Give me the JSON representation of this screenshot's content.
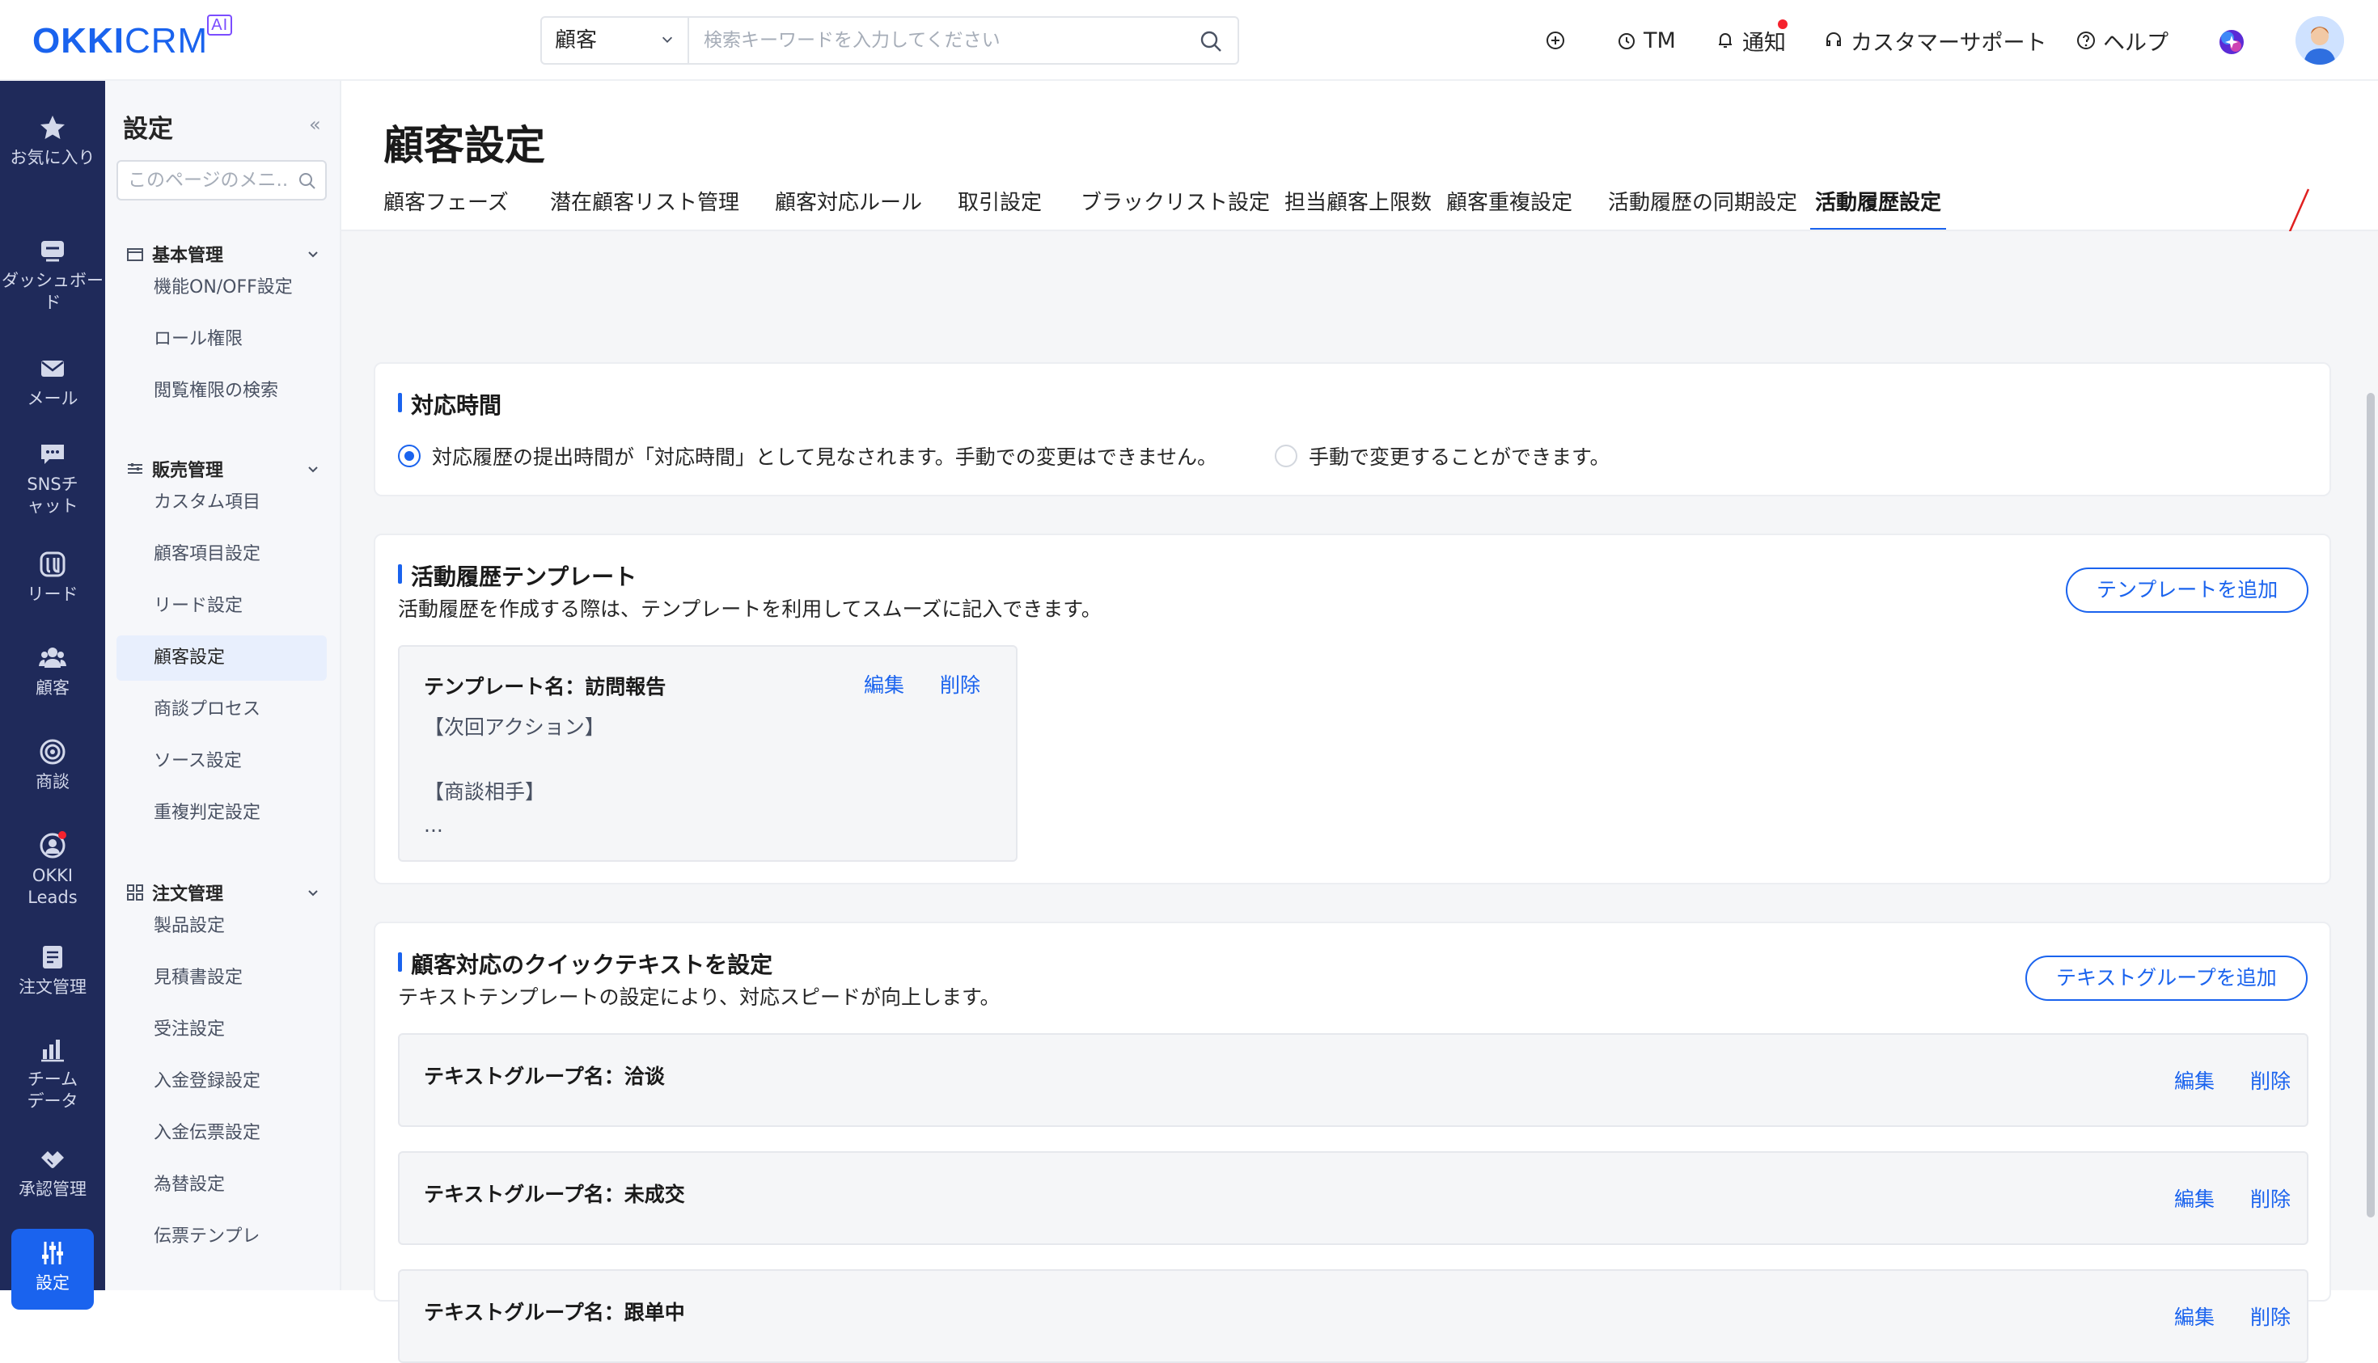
{
  "brand": {
    "name": "OKKI",
    "crm": "CRM",
    "ai": "AI"
  },
  "search": {
    "scope": "顧客",
    "placeholder": "検索キーワードを入力してください"
  },
  "topbar": {
    "tm": "TM",
    "notify": "通知",
    "support": "カスタマーサポート",
    "help": "ヘルプ"
  },
  "leftnav": [
    {
      "label": "お気に入り",
      "icon": "star-icon"
    },
    {
      "label": "ダッシュボード",
      "icon": "dashboard-icon"
    },
    {
      "label": "メール",
      "icon": "mail-icon"
    },
    {
      "label": "SNSチャット",
      "icon": "chat-icon"
    },
    {
      "label": "リード",
      "icon": "lead-icon"
    },
    {
      "label": "顧客",
      "icon": "customer-icon"
    },
    {
      "label": "商談",
      "icon": "target-icon"
    },
    {
      "label": "OKKI Leads",
      "icon": "leads-icon"
    },
    {
      "label": "注文管理",
      "icon": "order-icon"
    },
    {
      "label": "チームデータ",
      "icon": "chart-icon"
    },
    {
      "label": "承認管理",
      "icon": "approve-icon"
    },
    {
      "label": "設定",
      "icon": "settings-icon"
    }
  ],
  "subnav": {
    "title": "設定",
    "collapse": "«",
    "search_placeholder": "このページのメニ...",
    "groups": [
      {
        "label": "基本管理",
        "items": [
          "機能ON/OFF設定",
          "ロール権限",
          "閲覧権限の検索"
        ]
      },
      {
        "label": "販売管理",
        "items": [
          "カスタム項目",
          "顧客項目設定",
          "リード設定",
          "顧客設定",
          "商談プロセス",
          "ソース設定",
          "重複判定設定"
        ]
      },
      {
        "label": "注文管理",
        "items": [
          "製品設定",
          "見積書設定",
          "受注設定",
          "入金登録設定",
          "入金伝票設定",
          "為替設定",
          "伝票テンプレ"
        ]
      }
    ]
  },
  "page": {
    "title": "顧客設定",
    "tabs": [
      "顧客フェーズ",
      "潜在顧客リスト管理",
      "顧客対応ルール",
      "取引設定",
      "ブラックリスト設定",
      "担当顧客上限数",
      "顧客重複設定",
      "活動履歴の同期設定",
      "活動履歴設定"
    ]
  },
  "response_time": {
    "title": "対応時間",
    "option1": "対応履歴の提出時間が「対応時間」として見なされます。手動での変更はできません。",
    "option2": "手動で変更することができます。"
  },
  "template": {
    "title": "活動履歴テンプレート",
    "desc": "活動履歴を作成する際は、テンプレートを利用してスムーズに記入できます。",
    "add": "テンプレートを追加",
    "item": {
      "name": "テンプレート名：訪問報告",
      "edit": "編集",
      "delete": "削除",
      "line1": "【次回アクション】",
      "line2": "【商談相手】",
      "line3": "..."
    }
  },
  "quicktext": {
    "title": "顧客対応のクイックテキストを設定",
    "desc": "テキストテンプレートの設定により、対応スピードが向上します。",
    "add": "テキストグループを追加",
    "groups": [
      {
        "name": "テキストグループ名：洽谈",
        "edit": "編集",
        "delete": "削除"
      },
      {
        "name": "テキストグループ名：未成交",
        "edit": "編集",
        "delete": "削除"
      },
      {
        "name": "テキストグループ名：跟单中",
        "edit": "編集",
        "delete": "削除"
      }
    ]
  },
  "colors": {
    "accent": "#1a63ee",
    "nav": "#1f2a5a",
    "alert": "#f5222d"
  }
}
